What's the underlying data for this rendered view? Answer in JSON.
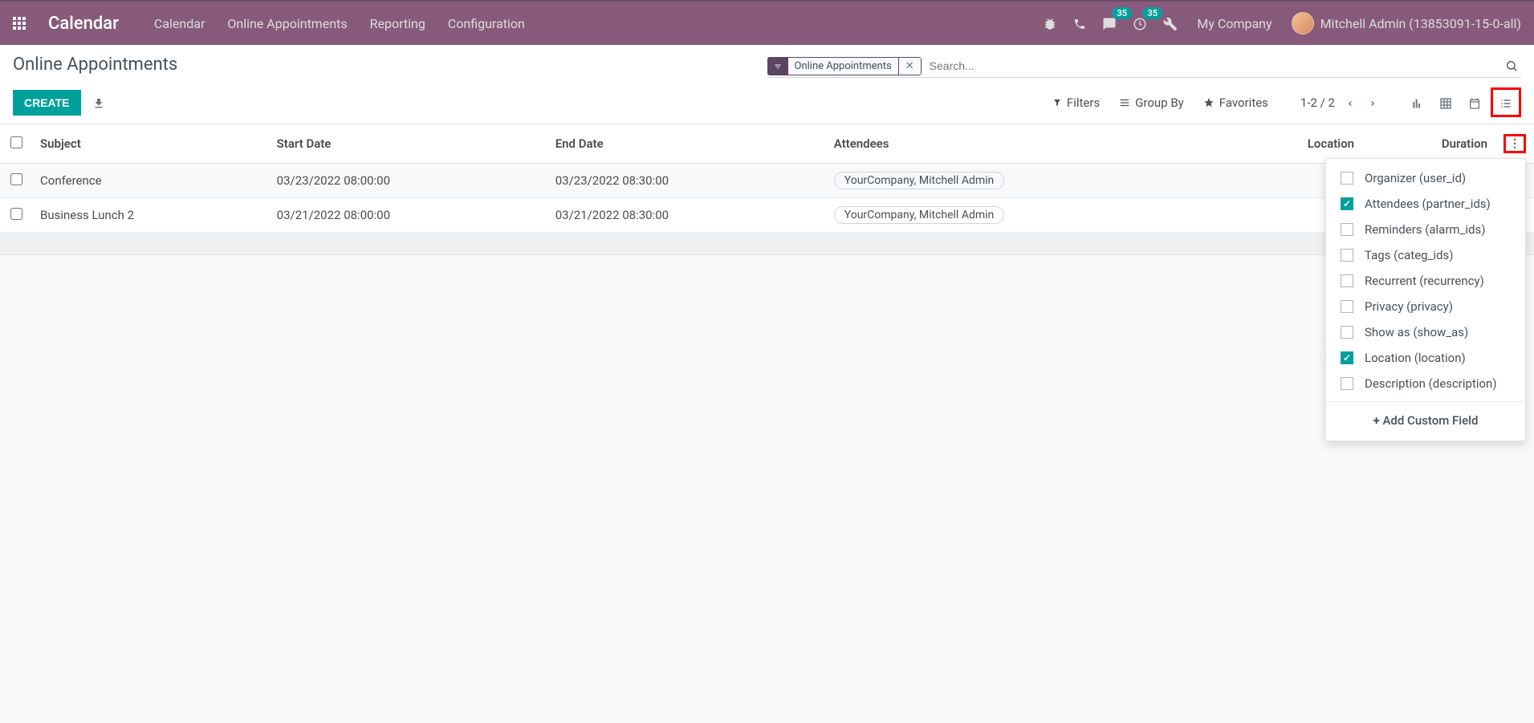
{
  "navbar": {
    "brand": "Calendar",
    "items": [
      "Calendar",
      "Online Appointments",
      "Reporting",
      "Configuration"
    ],
    "msg_badge": "35",
    "activity_badge": "35",
    "company": "My Company",
    "user": "Mitchell Admin (13853091-15-0-all)"
  },
  "breadcrumb": "Online Appointments",
  "search": {
    "facet_label": "Online Appointments",
    "placeholder": "Search..."
  },
  "buttons": {
    "create": "CREATE"
  },
  "search_options": {
    "filters": "Filters",
    "groupby": "Group By",
    "favorites": "Favorites"
  },
  "pager": {
    "range": "1-2 / 2"
  },
  "columns": {
    "subject": "Subject",
    "start": "Start Date",
    "end": "End Date",
    "attendees": "Attendees",
    "location": "Location",
    "duration": "Duration"
  },
  "rows": [
    {
      "subject": "Conference",
      "start": "03/23/2022 08:00:00",
      "end": "03/23/2022 08:30:00",
      "attendee": "YourCompany, Mitchell Admin",
      "location": "",
      "duration": ""
    },
    {
      "subject": "Business Lunch 2",
      "start": "03/21/2022 08:00:00",
      "end": "03/21/2022 08:30:00",
      "attendee": "YourCompany, Mitchell Admin",
      "location": "",
      "duration": ""
    }
  ],
  "dropdown": {
    "items": [
      {
        "label": "Organizer (user_id)",
        "checked": false
      },
      {
        "label": "Attendees (partner_ids)",
        "checked": true
      },
      {
        "label": "Reminders (alarm_ids)",
        "checked": false
      },
      {
        "label": "Tags (categ_ids)",
        "checked": false
      },
      {
        "label": "Recurrent (recurrency)",
        "checked": false
      },
      {
        "label": "Privacy (privacy)",
        "checked": false
      },
      {
        "label": "Show as (show_as)",
        "checked": false
      },
      {
        "label": "Location (location)",
        "checked": true
      },
      {
        "label": "Description (description)",
        "checked": false
      }
    ],
    "add_field": "Add Custom Field"
  }
}
